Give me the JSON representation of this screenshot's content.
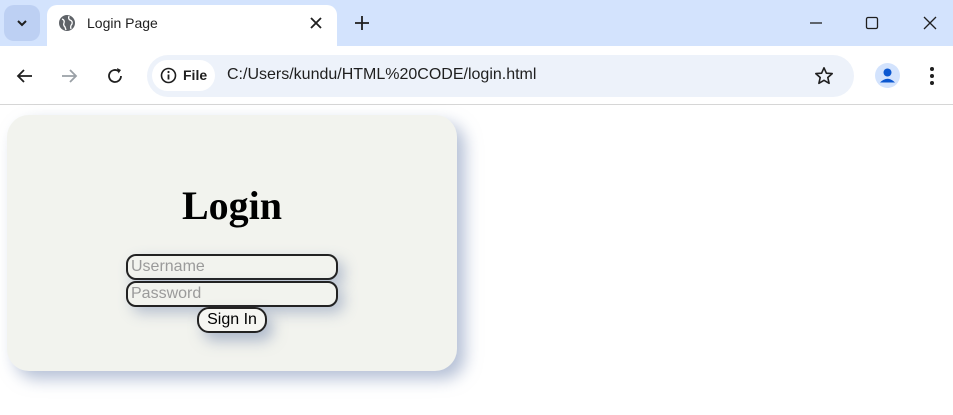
{
  "browser": {
    "tab": {
      "title": "Login Page"
    },
    "address": {
      "scheme_label": "File",
      "url": "C:/Users/kundu/HTML%20CODE/login.html"
    },
    "icons": {
      "tab_search": "chevron-down-icon",
      "tab_favicon": "globe-icon",
      "tab_close": "close-icon",
      "new_tab": "plus-icon",
      "back": "arrow-left-icon",
      "forward": "arrow-right-icon",
      "reload": "reload-icon",
      "site_info": "info-icon",
      "bookmark": "star-icon",
      "profile": "person-icon",
      "menu": "kebab-menu-icon",
      "minimize": "minimize-icon",
      "maximize": "maximize-icon",
      "close_window": "close-window-icon"
    },
    "colors": {
      "tabstrip": "#d3e3fd",
      "omnibox": "#edf2fa",
      "profile_accent": "#0b57d0"
    }
  },
  "page": {
    "title": "Login",
    "username": {
      "placeholder": "Username",
      "value": ""
    },
    "password": {
      "placeholder": "Password",
      "value": ""
    },
    "signin_label": "Sign In",
    "colors": {
      "card_bg": "#f2f3ee",
      "shadow": "#7d8fb8"
    }
  }
}
